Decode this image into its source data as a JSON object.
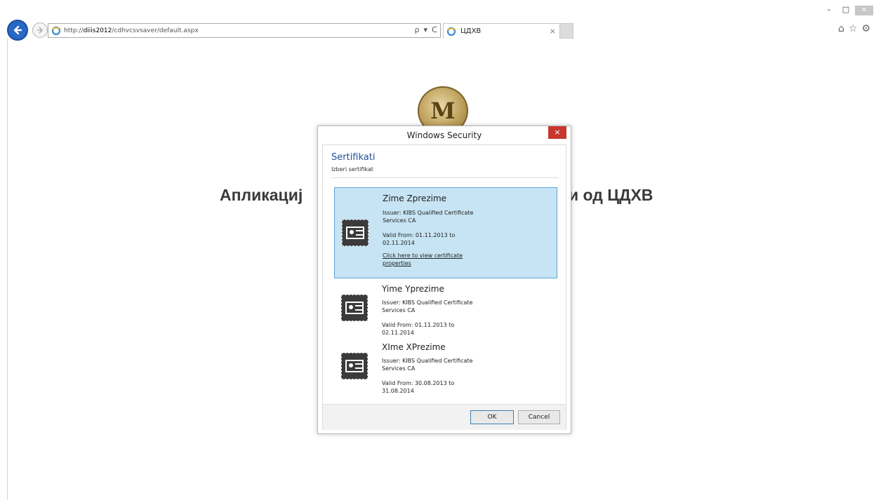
{
  "window": {
    "minimize": "–",
    "maximize": "□",
    "close": "×"
  },
  "browser": {
    "address": {
      "prefix": "http://",
      "host": "diiis2012",
      "path": "/cdhvcsvsaver/default.aspx"
    },
    "tab": {
      "title": "ЦДХВ",
      "close": "×"
    },
    "tools": {
      "search": "ρ",
      "refresh": "ᑕ",
      "home": "⌂",
      "favorites": "☆",
      "settings": "⚙"
    }
  },
  "page": {
    "seal_letter": "M",
    "heading_left": "Апликациј",
    "heading_right": "и од ЦДХВ"
  },
  "dialog": {
    "title": "Windows Security",
    "close": "×",
    "heading": "Sertifikati",
    "subheading": "Izberi sertifikat",
    "certificates": [
      {
        "name": "Zime Zprezime",
        "issuer": "Issuer: KIBS Qualified Certificate Services CA",
        "valid": "Valid From: 01.11.2013 to 02.11.2014",
        "link": "Click here to view certificate properties",
        "selected": true
      },
      {
        "name": "Yime Yprezime",
        "issuer": "Issuer: KIBS Qualified Certificate Services CA",
        "valid": "Valid From: 01.11.2013 to 02.11.2014",
        "selected": false
      },
      {
        "name": "XIme XPrezime",
        "issuer": "Issuer: KIBS Qualified Certificate Services CA",
        "valid": "Valid From: 30.08.2013 to 31.08.2014",
        "selected": false
      }
    ],
    "ok_label": "OK",
    "cancel_label": "Cancel"
  }
}
